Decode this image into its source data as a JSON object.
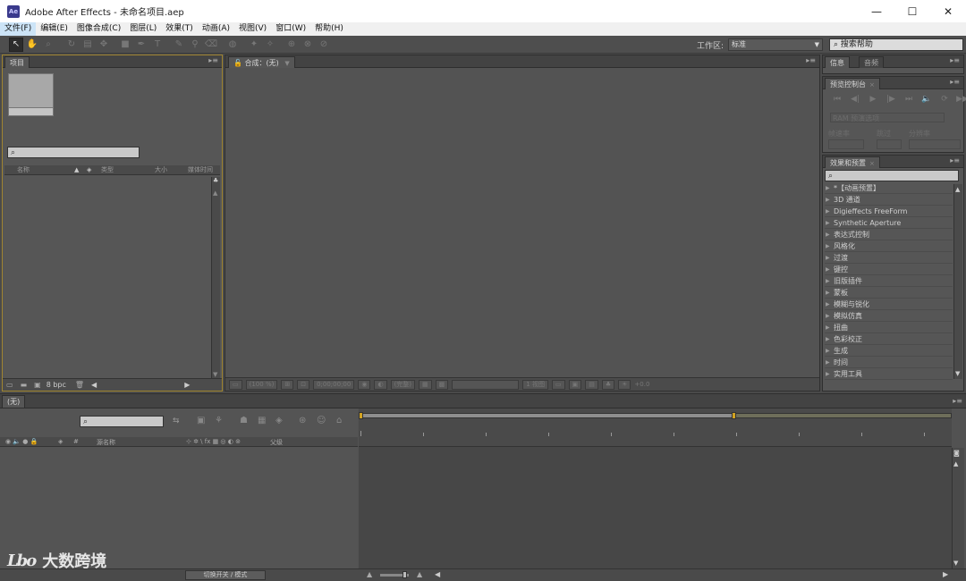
{
  "window": {
    "logo": "Ae",
    "title": "Adobe After Effects - 未命名项目.aep",
    "minimize": "—",
    "maximize": "☐",
    "close": "✕"
  },
  "menu": [
    "文件(F)",
    "编辑(E)",
    "图像合成(C)",
    "图层(L)",
    "效果(T)",
    "动画(A)",
    "视图(V)",
    "窗口(W)",
    "帮助(H)"
  ],
  "toolbar": {
    "workspace_label": "工作区:",
    "workspace_value": "标准",
    "help_search": "搜索帮助"
  },
  "project_panel": {
    "tab": "项目",
    "columns": {
      "name": "名称",
      "type": "类型",
      "size": "大小",
      "duration": "媒体时间"
    },
    "bpc": "8 bpc"
  },
  "comp_panel": {
    "tab": "合成：(无)",
    "footer": {
      "zoom": "(100 %)",
      "timecode": "0;00;00;00",
      "resolution": "(完整)",
      "view": "1 视图",
      "exposure": "+0.0"
    }
  },
  "info_panel": {
    "tab_info": "信息",
    "tab_audio": "音频"
  },
  "preview_panel": {
    "tab": "预览控制台",
    "ram_options": "RAM 预演选项",
    "frame_rate": "帧速率",
    "skip": "跳过",
    "resolution": "分辨率"
  },
  "effects_panel": {
    "tab": "效果和预置",
    "items": [
      "*【动画预置】",
      "3D 通道",
      "Digieffects FreeForm",
      "Synthetic Aperture",
      "表达式控制",
      "风格化",
      "过渡",
      "键控",
      "旧版插件",
      "蒙板",
      "模糊与锐化",
      "模拟仿真",
      "扭曲",
      "色彩校正",
      "生成",
      "时间",
      "实用工具"
    ]
  },
  "timeline": {
    "tab": "(无)",
    "col_source": "源名称",
    "col_parent": "父级",
    "switch_button": "切换开关 / 模式"
  },
  "watermark": {
    "logo": "Lbo",
    "text": "大数跨境"
  }
}
